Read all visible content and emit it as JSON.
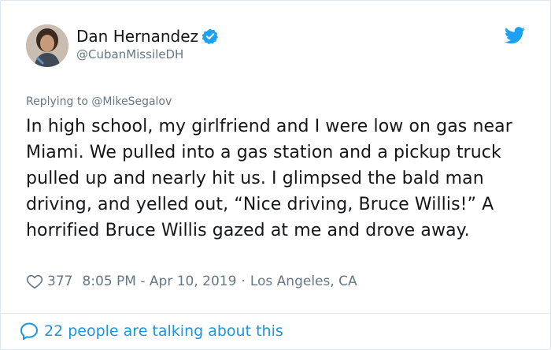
{
  "user": {
    "display_name": "Dan Hernandez",
    "handle": "@CubanMissileDH",
    "verified": true
  },
  "reply": {
    "prefix": "Replying to",
    "mention": "@MikeSegalov"
  },
  "tweet": {
    "text": "In high school, my girlfriend and I were low on gas near Miami. We pulled into a gas station and a pickup truck pulled up and nearly hit us. I glimpsed the bald man driving, and yelled out, “Nice driving, Bruce Willis!” A horrified Bruce Willis gazed at me and drove away.",
    "likes": "377",
    "time": "8:05 PM - Apr 10, 2019",
    "separator": "·",
    "location": "Los Angeles, CA"
  },
  "footer": {
    "conversation_label": "22 people are talking about this"
  },
  "colors": {
    "accent": "#1da1f2",
    "link": "#1b95e0",
    "muted": "#657786",
    "text": "#14171a"
  },
  "icons": [
    "verified-badge-icon",
    "twitter-bird-icon",
    "heart-icon",
    "speech-bubble-icon"
  ]
}
